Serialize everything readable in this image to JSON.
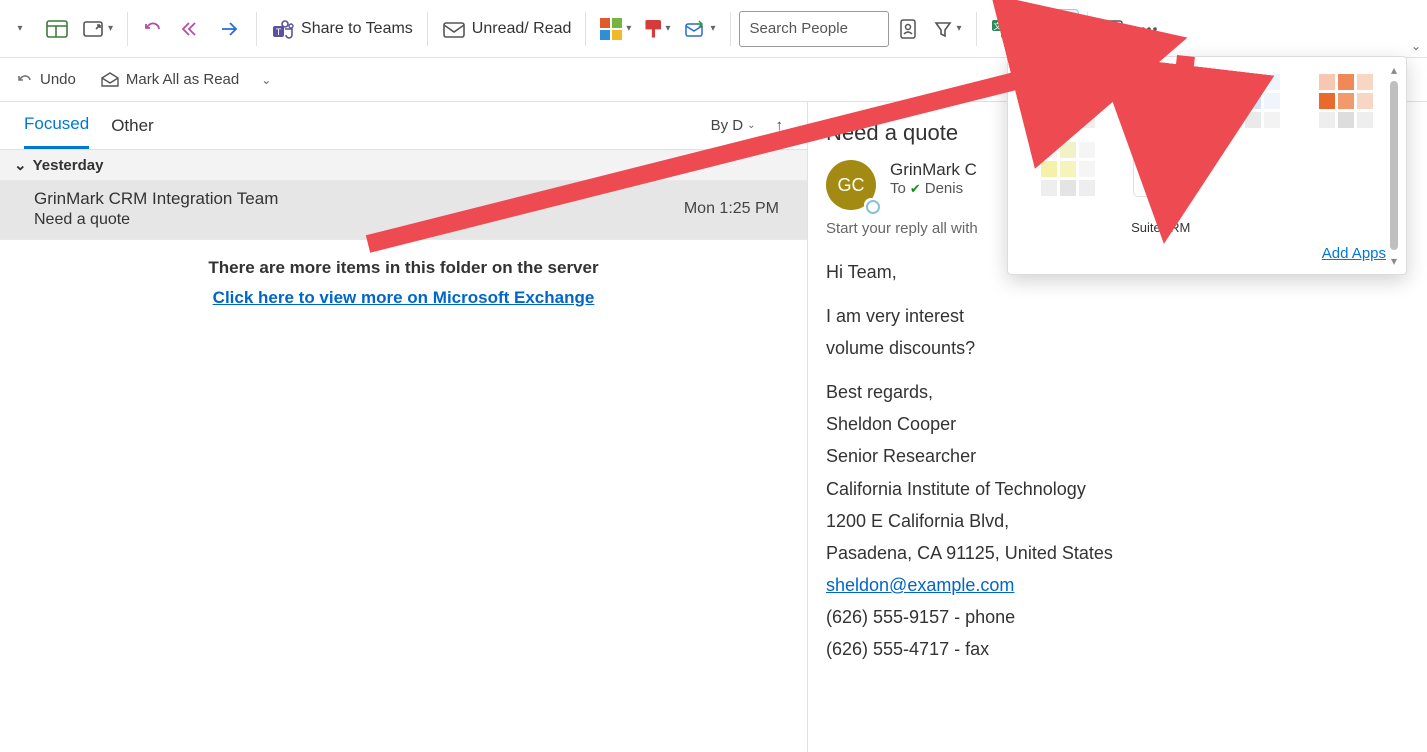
{
  "toolbar": {
    "share_teams": "Share to Teams",
    "unread_read": "Unread/ Read",
    "search_placeholder": "Search People"
  },
  "subbar": {
    "undo": "Undo",
    "mark_all": "Mark All as Read"
  },
  "list": {
    "tab_focused": "Focused",
    "tab_other": "Other",
    "sort_label": "By D",
    "group1": "Yesterday",
    "msg1_from": "GrinMark CRM Integration Team",
    "msg1_subj": "Need a quote",
    "msg1_time": "Mon 1:25 PM",
    "more_hint": "There are more items in this folder on the server",
    "more_link": "Click here to view more on Microsoft Exchange"
  },
  "reading": {
    "subject": "Need a quote",
    "avatar_initials": "GC",
    "from": "GrinMark C",
    "to_label": "To",
    "to_name": "Denis",
    "reply_hint": "Start your reply all with",
    "body_line1": "Hi Team,",
    "body_line2": "I am very interest",
    "body_line3": "volume discounts?",
    "body_line4": "Best regards,",
    "body_line5": "Sheldon Cooper",
    "body_line6": "Senior Researcher",
    "body_line7": "California Institute of Technology",
    "body_line8": "1200 E California Blvd,",
    "body_line9": "Pasadena, CA 91125, United States",
    "body_email": "sheldon@example.com",
    "body_phone": "(626) 555-9157 - phone",
    "body_fax": "(626) 555-4717 - fax"
  },
  "apps": {
    "suitecrm_prefix": "<>",
    "suitecrm_name": "SuiteCRM",
    "add_apps": "Add Apps"
  }
}
